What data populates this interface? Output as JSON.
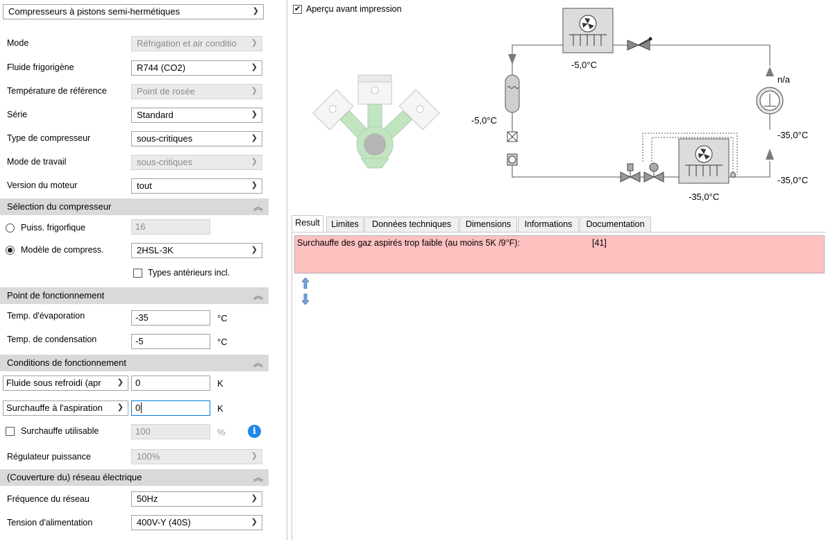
{
  "left": {
    "product_select": "Compresseurs à pistons semi-hermétiques",
    "fields": {
      "mode": {
        "label": "Mode",
        "value": "Réfrigation et air conditio"
      },
      "fluid": {
        "label": "Fluide frigorigène",
        "value": "R744 (CO2)"
      },
      "ref_temp": {
        "label": "Température de référence",
        "value": "Point de rosée"
      },
      "series": {
        "label": "Série",
        "value": "Standard"
      },
      "comp_type": {
        "label": "Type de compresseur",
        "value": "sous-critiques"
      },
      "work_mode": {
        "label": "Mode de travail",
        "value": "sous-critiques"
      },
      "motor": {
        "label": "Version du moteur",
        "value": "tout"
      }
    },
    "sections": {
      "selection": "Sélection du compresseur",
      "operating_point": "Point de fonctionnement",
      "operating_conditions": "Conditions de fonctionnement",
      "grid": "(Couverture du) réseau électrique"
    },
    "selection": {
      "capacity_label": "Puiss. frigorfique",
      "capacity_value": "16",
      "model_label": "Modèle de compress.",
      "model_value": "2HSL-3K",
      "older_types_label": "Types antérieurs incl."
    },
    "operating_point": {
      "evap_label": "Temp. d'évaporation",
      "evap_value": "-35",
      "evap_unit": "°C",
      "cond_label": "Temp. de condensation",
      "cond_value": "-5",
      "cond_unit": "°C"
    },
    "conditions": {
      "subcool_select": "Fluide sous refroidi (apr",
      "subcool_value": "0",
      "subcool_unit": "K",
      "superheat_select": "Surchauffe à l'aspiration",
      "superheat_value": "0",
      "superheat_unit": "K",
      "useful_superheat_label": "Surchauffe utilisable",
      "useful_superheat_value": "100",
      "useful_superheat_unit": "%",
      "capacity_control_label": "Régulateur puissance",
      "capacity_control_value": "100%"
    },
    "grid": {
      "freq_label": "Fréquence du réseau",
      "freq_value": "50Hz",
      "voltage_label": "Tension d'alimentation",
      "voltage_value": "400V-Y (40S)"
    }
  },
  "right": {
    "print_preview_label": "Aperçu avant impression",
    "diagram": {
      "t_cond_top": "-5,0°C",
      "t_left": "-5,0°C",
      "t_na": "n/a",
      "t_right_top": "-35,0°C",
      "t_right_bottom": "-35,0°C",
      "t_evap_bottom": "-35,0°C"
    },
    "tabs": [
      "Result",
      "Limites",
      "Données techniques",
      "Dimensions",
      "Informations",
      "Documentation"
    ],
    "result": {
      "message": "Surchauffe des gaz aspirés trop faible (au moins 5K /9°F):",
      "code": "[41]"
    }
  },
  "colors": {
    "section_bg": "#d9d9d9",
    "error_bg": "#ffc0c0",
    "accent": "#1e88e5",
    "compressor_green": "#8fd18f"
  }
}
